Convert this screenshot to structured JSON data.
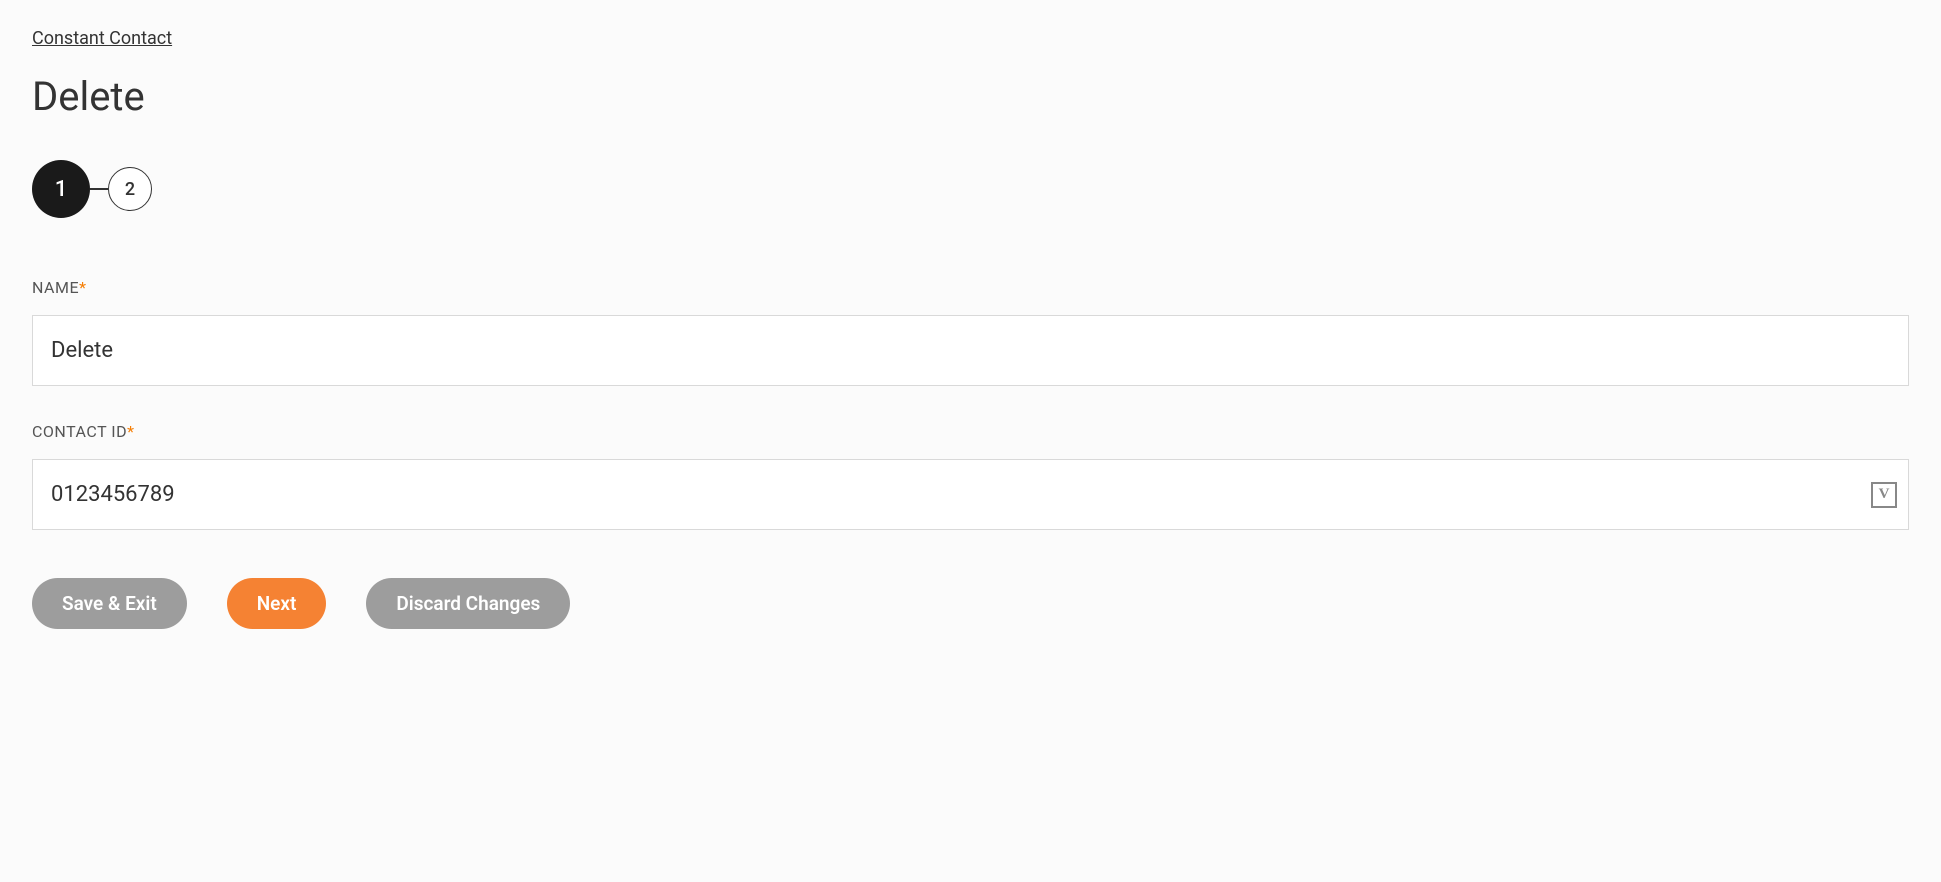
{
  "breadcrumb": "Constant Contact",
  "page_title": "Delete",
  "stepper": {
    "active_step": "1",
    "next_step": "2"
  },
  "fields": {
    "name": {
      "label": "NAME",
      "required_mark": "*",
      "value": "Delete"
    },
    "contact_id": {
      "label": "CONTACT ID",
      "required_mark": "*",
      "value": "0123456789",
      "variable_icon_glyph": "V"
    }
  },
  "buttons": {
    "save_exit": "Save & Exit",
    "next": "Next",
    "discard": "Discard Changes"
  }
}
